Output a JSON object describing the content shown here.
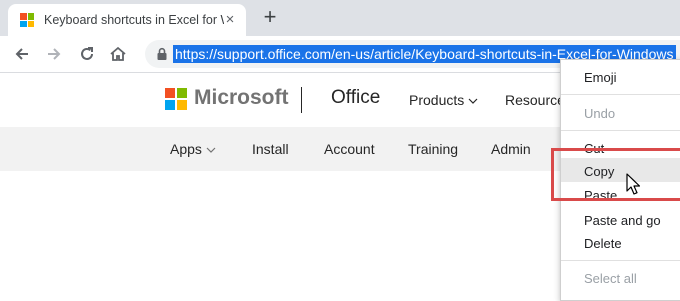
{
  "browser": {
    "tab": {
      "title": "Keyboard shortcuts in Excel for Windows",
      "favicon": "microsoft-logo",
      "close_icon": "×"
    },
    "new_tab_icon": "+",
    "toolbar": {
      "back_icon": "arrow-left-icon",
      "forward_icon": "arrow-right-icon",
      "reload_icon": "reload-icon",
      "home_icon": "home-icon",
      "lock_icon": "lock-icon",
      "url": "https://support.office.com/en-us/article/Keyboard-shortcuts-in-Excel-for-Windows"
    }
  },
  "site": {
    "brand": "Microsoft",
    "product": "Office",
    "nav": [
      "Products",
      "Resources"
    ],
    "subnav": [
      "Apps",
      "Install",
      "Account",
      "Training",
      "Admin"
    ]
  },
  "context_menu": {
    "items": [
      {
        "label": "Emoji",
        "enabled": true
      },
      {
        "label": "Undo",
        "enabled": false
      },
      {
        "label": "Cut",
        "enabled": true
      },
      {
        "label": "Copy",
        "enabled": true,
        "highlighted": true
      },
      {
        "label": "Paste",
        "enabled": true
      },
      {
        "label": "Paste and go",
        "enabled": true
      },
      {
        "label": "Delete",
        "enabled": true
      },
      {
        "label": "Select all",
        "enabled": false
      }
    ]
  },
  "colors": {
    "ms_red": "#f25022",
    "ms_green": "#7fba00",
    "ms_blue": "#00a4ef",
    "ms_yellow": "#ffb900",
    "url_selection": "#1a73e8",
    "annotation_red": "#d94a4a"
  }
}
